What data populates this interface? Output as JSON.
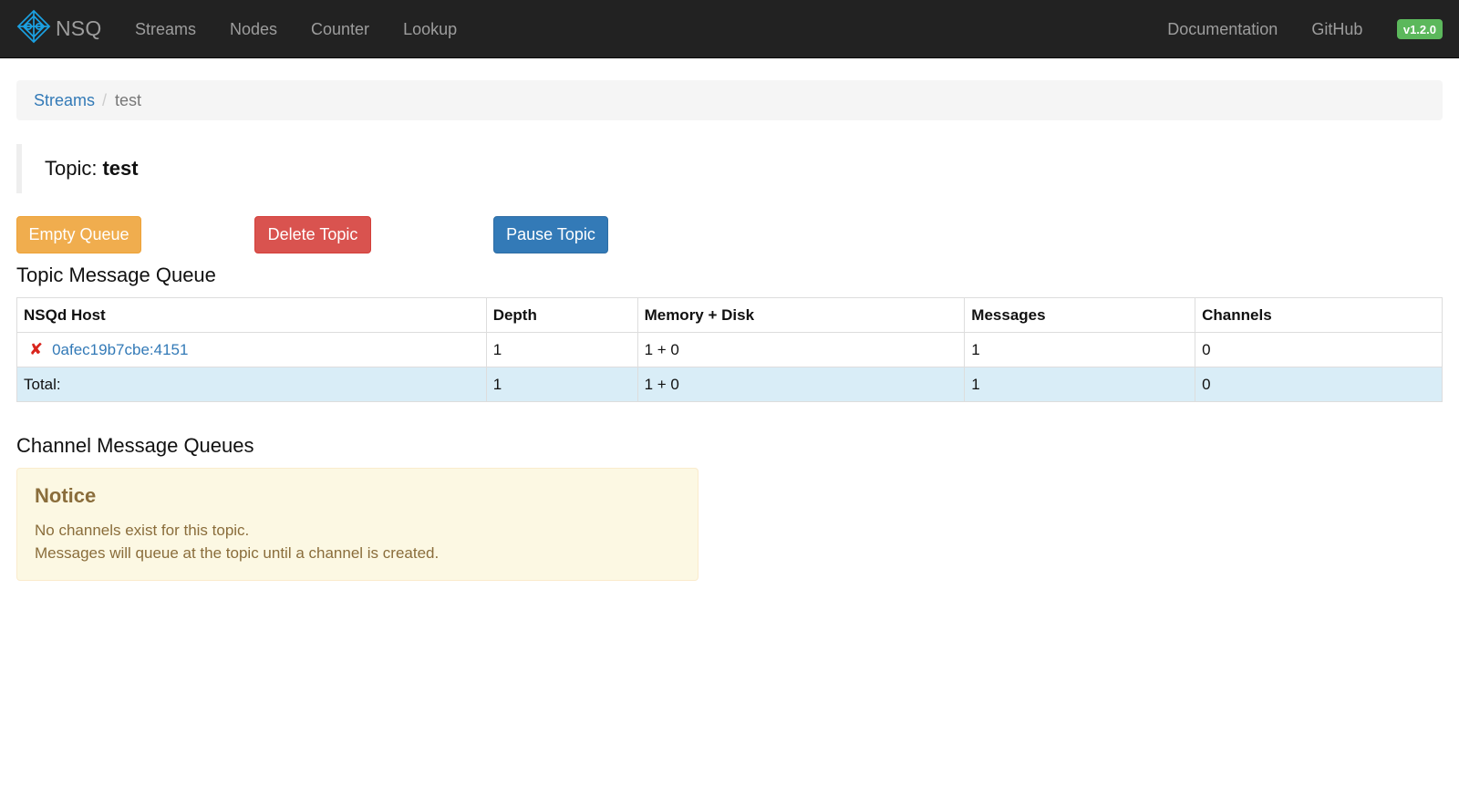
{
  "navbar": {
    "brand": "NSQ",
    "links": [
      "Streams",
      "Nodes",
      "Counter",
      "Lookup"
    ],
    "right_links": [
      "Documentation",
      "GitHub"
    ],
    "version": "v1.2.0",
    "brand_color": "#1ba1e2"
  },
  "breadcrumb": {
    "root": "Streams",
    "separator": "/",
    "current": "test"
  },
  "topic": {
    "label": "Topic:",
    "name": "test"
  },
  "actions": {
    "empty_queue": "Empty Queue",
    "delete_topic": "Delete Topic",
    "pause_topic": "Pause Topic"
  },
  "topic_queue": {
    "heading": "Topic Message Queue",
    "columns": [
      "NSQd Host",
      "Depth",
      "Memory + Disk",
      "Messages",
      "Channels"
    ],
    "rows": [
      {
        "status_icon": "x-mark-icon",
        "host": "0afec19b7cbe:4151",
        "depth": "1",
        "memory_disk": "1 + 0",
        "messages": "1",
        "channels": "0"
      }
    ],
    "total": {
      "label": "Total:",
      "depth": "1",
      "memory_disk": "1 + 0",
      "messages": "1",
      "channels": "0"
    }
  },
  "channel_queues": {
    "heading": "Channel Message Queues",
    "notice": {
      "title": "Notice",
      "line1": "No channels exist for this topic.",
      "line2": "Messages will queue at the topic until a channel is created."
    }
  }
}
